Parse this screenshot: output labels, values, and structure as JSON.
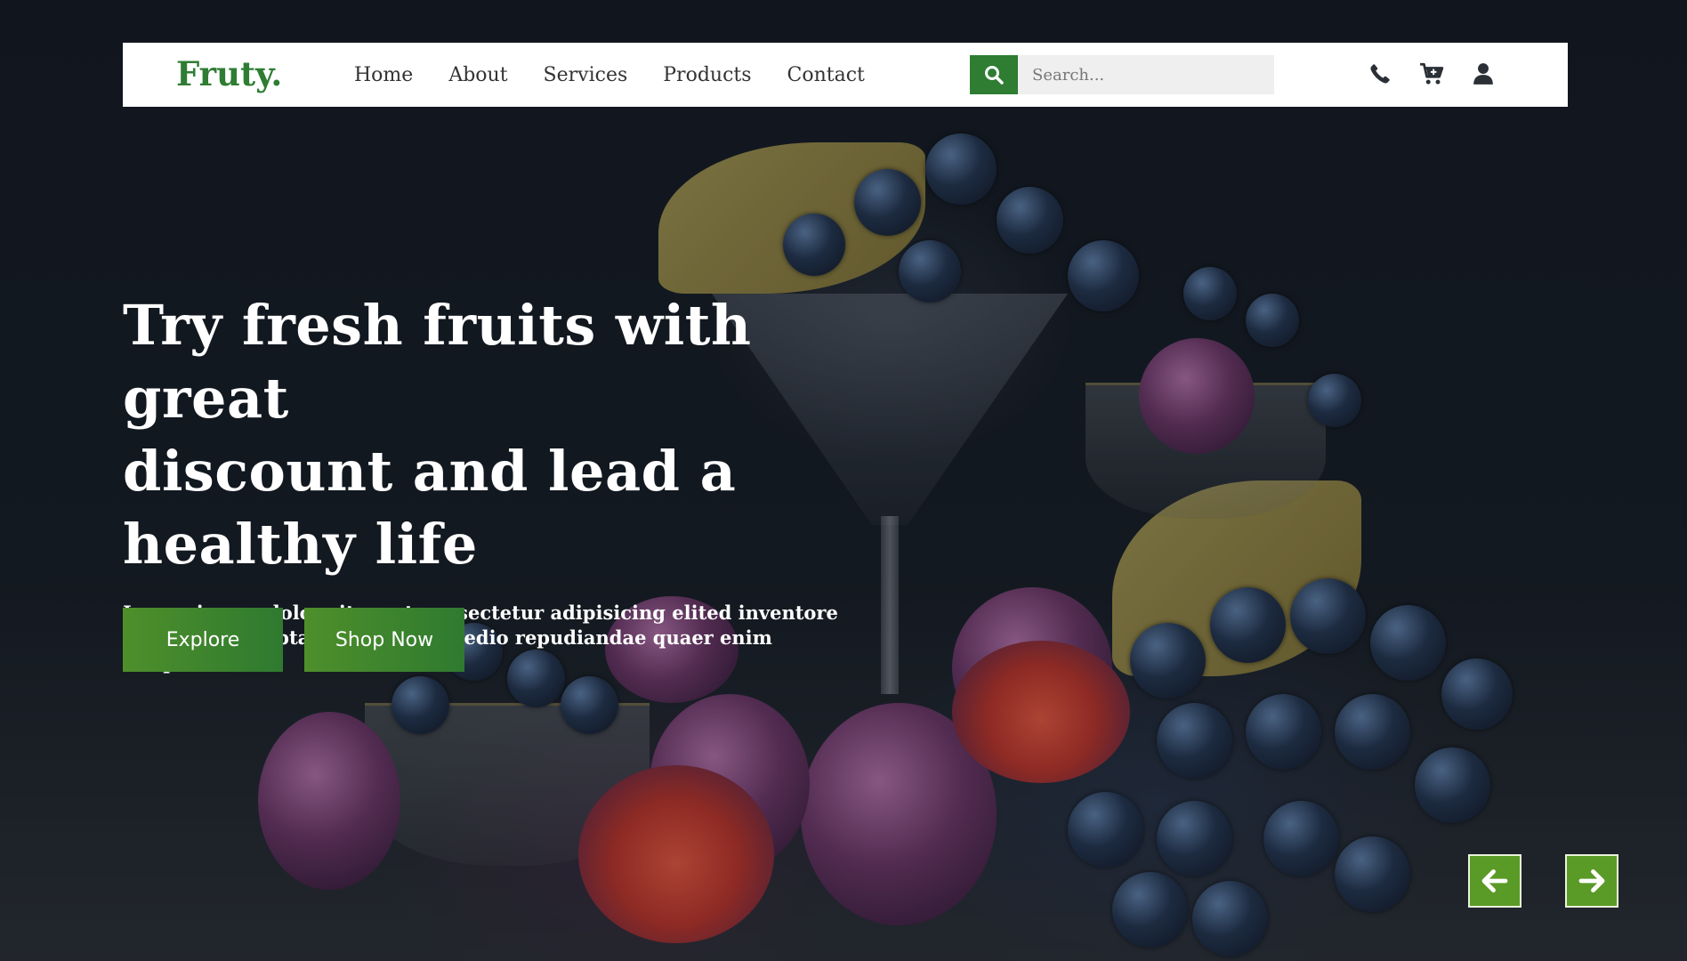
{
  "brand": {
    "logo": "Fruty.",
    "accent": "#2e7d32"
  },
  "nav": {
    "links": [
      {
        "label": "Home"
      },
      {
        "label": "About"
      },
      {
        "label": "Services"
      },
      {
        "label": "Products"
      },
      {
        "label": "Contact"
      }
    ]
  },
  "search": {
    "placeholder": "Search...",
    "value": "",
    "icon": "search-icon"
  },
  "icons": [
    "phone-icon",
    "cart-icon",
    "user-icon"
  ],
  "hero": {
    "headline_lines": [
      "Try fresh fruits with great",
      "discount and lead a",
      "healthy life"
    ],
    "lead_lines": [
      "Lorem ipsum dolor sit amet consectetur adipisicing elited inventore",
      "quisquam voluptate laudantium edio repudiandae quaer enim tempore."
    ],
    "buttons": {
      "explore": "Explore",
      "shop": "Shop Now"
    },
    "button_color": "#4e8f2b"
  },
  "slider": {
    "prev_icon": "arrow-left-icon",
    "next_icon": "arrow-right-icon",
    "arrow_color": "#5a9a26"
  }
}
